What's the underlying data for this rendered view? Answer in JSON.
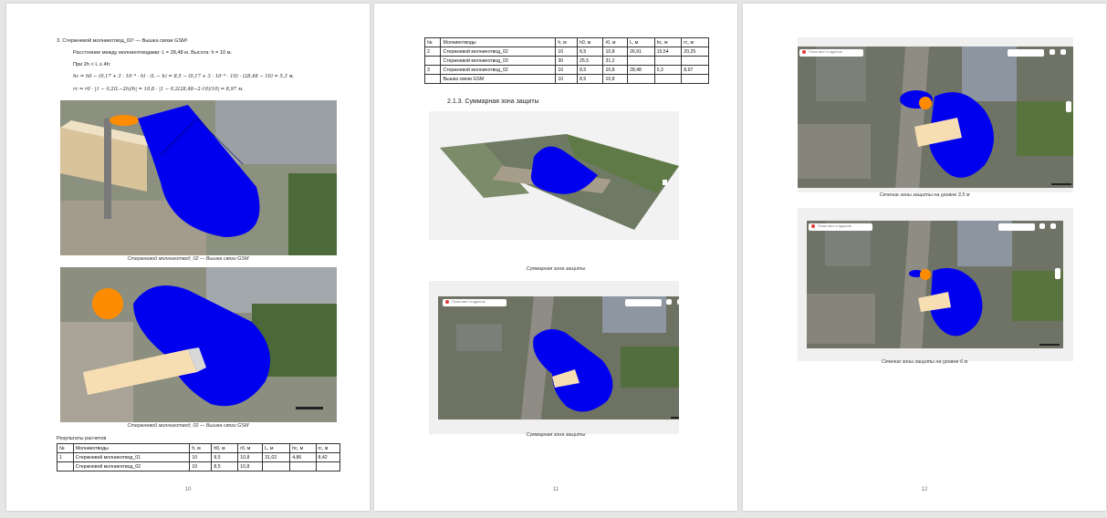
{
  "page1": {
    "heading": "3. Стержневой молниеотвод_02¹ — Вышка связи GSM¹",
    "line1": "Расстояние между молниеотводами: L = 28,48 м. Высота: h = 10 м.",
    "line2": "При 2h < L ≤ 4h:",
    "line3": "hc = h0 − (0,17 + 3 · 10⁻⁴ · h) · (L − h) = 8,5 − (0,17 + 3 · 10⁻⁴ · 10) · (28,48 − 10) = 5,3 м.",
    "line4": "rc = r0 · |1 − 0,2(L−2h)/h| = 10,8 · |1 − 0,2(28,48−2·10)/10| = 8,97 м.",
    "caption1": "Стержневой молниеотвод_02 — Вышка связи GSM",
    "caption2": "Стержневой молниеотвод_02 — Вышка связи GSM",
    "results_heading": "Результаты расчетов",
    "table": {
      "headers": [
        "№",
        "Молниеотводы",
        "h, м",
        "h0, м",
        "r0, м",
        "L, м",
        "hc, м",
        "rc, м"
      ],
      "rows": [
        [
          "1",
          "Стержневой молниеотвод_01",
          "10",
          "8,5",
          "10,8",
          "31,02",
          "4,86",
          "8,42"
        ],
        [
          "",
          "Стержневой молниеотвод_02",
          "10",
          "8,5",
          "10,8",
          "",
          "",
          ""
        ]
      ]
    },
    "page_number": "10"
  },
  "page2": {
    "table": {
      "headers": [
        "№",
        "Молниеотводы",
        "h, м",
        "h0, м",
        "r0, м",
        "L, м",
        "hc, м",
        "rc, м"
      ],
      "rows": [
        [
          "2",
          "Стержневой молниеотвод_02",
          "10",
          "8,5",
          "10,8",
          "26,91",
          "15,54",
          "20,25"
        ],
        [
          "",
          "Стержневой молниеотвод_03",
          "30",
          "25,5",
          "31,2",
          "",
          "",
          ""
        ],
        [
          "3",
          "Стержневой молниеотвод_02",
          "10",
          "8,5",
          "10,8",
          "28,48",
          "5,3",
          "8,97"
        ],
        [
          "",
          "Вышка связи GSM",
          "10",
          "8,5",
          "10,8",
          "",
          "",
          ""
        ]
      ]
    },
    "section_heading": "2.1.3.   Суммарная зона защиты",
    "caption1": "Суммарная зона защиты",
    "caption2": "Суммарная зона защиты",
    "map_search_placeholder": "Поиск мест и адресов",
    "page_number": "11"
  },
  "page3": {
    "caption1": "Сечение зоны защиты на уровне 3,5 м",
    "caption2": "Сечение зоны защиты на уровне 6 м",
    "map_search_placeholder": "Поиск мест и адресов",
    "page_number": "12"
  },
  "colors": {
    "zone_blue": "#0000ee",
    "mast_orange": "#ff8c00",
    "building": "#f7ddb2",
    "heading_blue": "#2e5f99"
  }
}
